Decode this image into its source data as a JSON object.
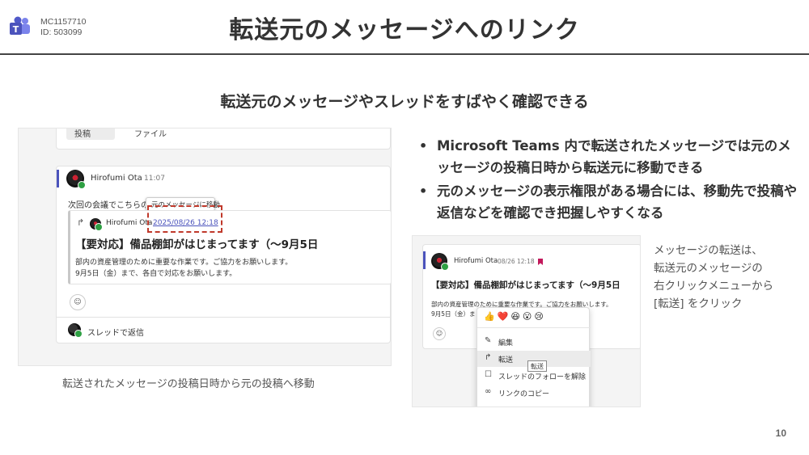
{
  "header": {
    "id_code": "MC1157710",
    "id_number": "ID: 503099",
    "title": "転送元のメッセージへのリンク",
    "logo_icon": "teams-logo-icon"
  },
  "subtitle": "転送元のメッセージやスレッドをすばやく確認できる",
  "left_screenshot": {
    "tab_post": "投稿",
    "tab_files": "ファイル",
    "author": "Hirofumi Ota",
    "time": "11:07",
    "body_line": "次回の会議でこちらの件",
    "tooltip": "元のメッセージに移動",
    "forward_author": "Hirofumi Ota",
    "forward_link": "2025/08/26 12:18",
    "forward_title": "【要対応】備品棚卸がはじまってます（〜9月5日",
    "forward_line1": "部内の資産管理のために重要な作業です。ご協力をお願いします。",
    "forward_line2": "9月5日（金）まで、各自で対応をお願いします。",
    "reply_label": "スレッドで返信"
  },
  "caption_left": "転送されたメッセージの投稿日時から元の投稿へ移動",
  "bullets": [
    "Microsoft Teams 内で転送されたメッセージでは元のメッセージの投稿日時から転送元に移動できる",
    "元のメッセージの表示権限がある場合には、移動先で投稿や返信などを確認でき把握しやすくなる"
  ],
  "right_screenshot": {
    "author": "Hirofumi Ota",
    "time": "08/26 12:18",
    "title": "【要対応】備品棚卸がはじまってます（〜9月5日",
    "line1": "部内の資産管理のために重要な作業です。ご協力をお願いします。",
    "line2": "9月5日（金）ま",
    "emojis": "👍❤️😆😮😢",
    "menu_edit": "編集",
    "menu_forward": "転送",
    "menu_unfollow": "スレッドのフォローを解除",
    "menu_copy_link": "リンクのコピー",
    "menu_tooltip": "転送"
  },
  "caption_right": [
    "メッセージの転送は、",
    "転送元のメッセージの",
    "右クリックメニューから",
    "[転送] をクリック"
  ],
  "page_number": "10",
  "colors": {
    "accent": "#4b53bc",
    "highlight": "#c0392b"
  }
}
